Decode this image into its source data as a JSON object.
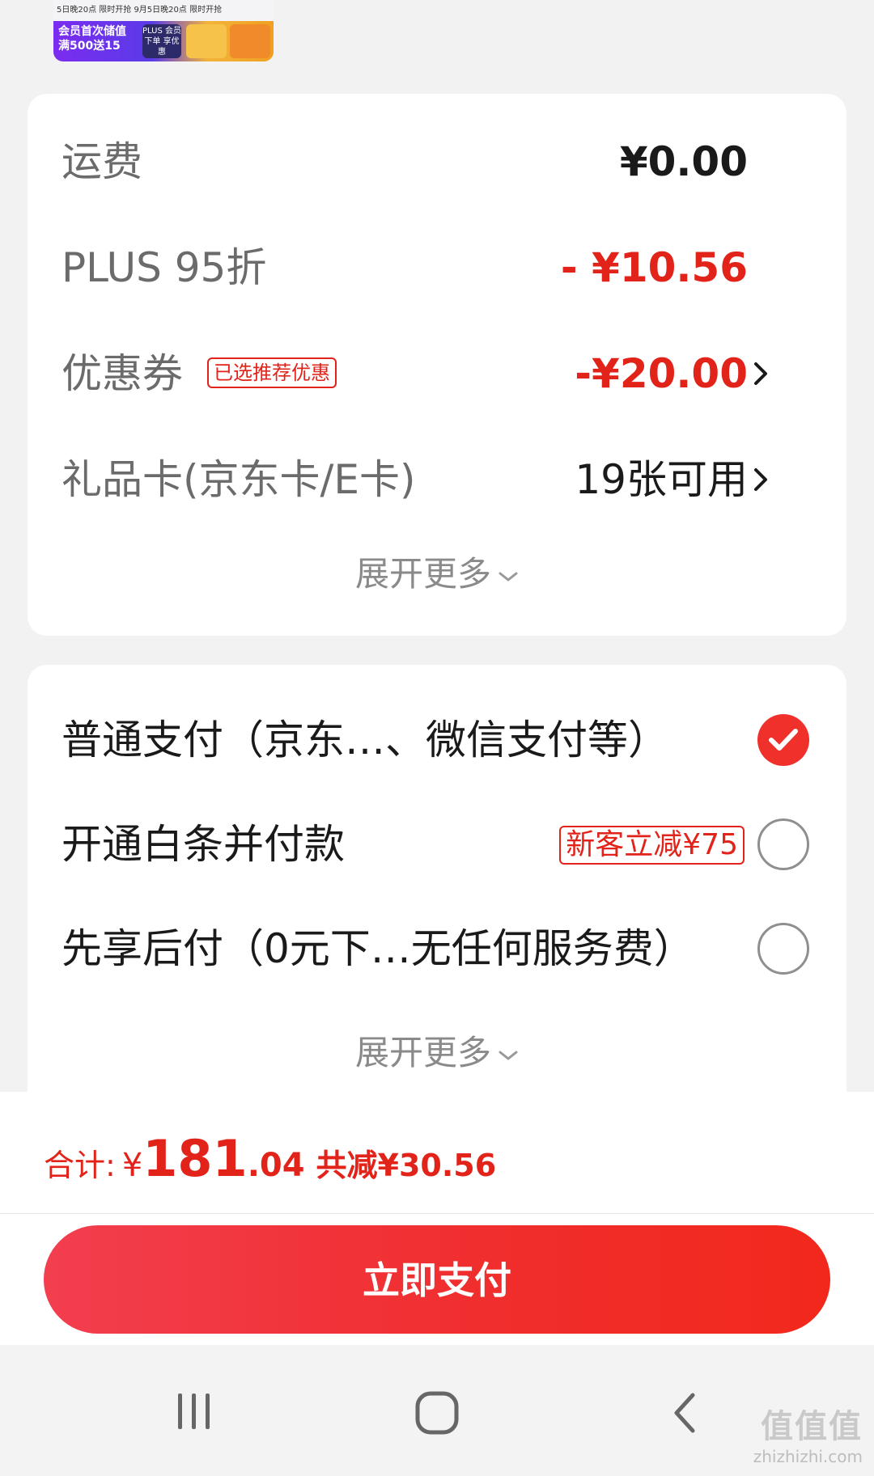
{
  "banner": {
    "strip_text": "5日晚20点 限时开抢  9月5日晚20点 限时开抢",
    "promo_line1": "会员首次储值",
    "promo_line2": "满500送15",
    "plus_badge": "PLUS 会员下单 享优惠"
  },
  "fees": {
    "shipping_label": "运费",
    "shipping_value": "¥0.00",
    "plus_label": "PLUS 95折",
    "plus_value": "- ¥10.56",
    "coupon_label": "优惠券",
    "coupon_tag": "已选推荐优惠",
    "coupon_value": "-¥20.00",
    "giftcard_label": "礼品卡(京东卡/E卡)",
    "giftcard_value": "19张可用",
    "expand_label": "展开更多"
  },
  "payment": {
    "options": [
      {
        "label": "普通支付（京东…、微信支付等）",
        "selected": true
      },
      {
        "label": "开通白条并付款",
        "tag": "新客立减¥75",
        "selected": false
      },
      {
        "label": "先享后付（0元下…无任何服务费）",
        "selected": false
      }
    ],
    "expand_label": "展开更多"
  },
  "summary": {
    "total_label": "合计:",
    "currency": "¥",
    "total_int": "181",
    "total_dec": ".04",
    "saved": "共减¥30.56"
  },
  "action": {
    "pay_button": "立即支付"
  },
  "watermark": {
    "brand": "值值值",
    "url": "zhizhizhi.com"
  },
  "colors": {
    "accent": "#e2231a",
    "button": "#f02e2e"
  }
}
